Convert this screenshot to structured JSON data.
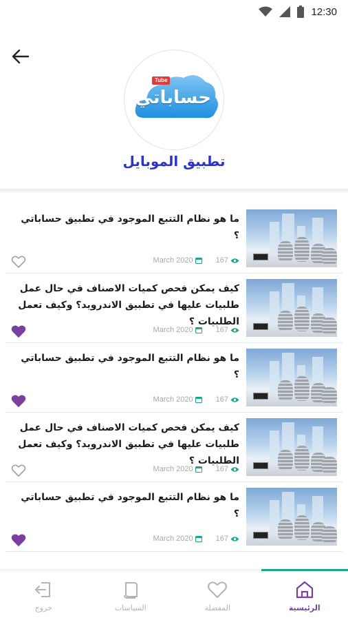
{
  "status_bar": {
    "time": "12:30"
  },
  "header": {
    "title": "تطبيق الموبايل",
    "logo_text": "حساباتي",
    "logo_badge": "Tube"
  },
  "articles": [
    {
      "title": "ما هو نظام التتبع الموجود في تطبيق حساباتي ؟",
      "date": "March 2020",
      "views": "167",
      "favorited": false
    },
    {
      "title": "كيف يمكن فحص كميات الاصناف في حال عمل طلبيات عليها في تطبيق الاندرويد؟ وكيف تعمل الطلبيات ؟",
      "date": "March 2020",
      "views": "167",
      "favorited": true
    },
    {
      "title": "ما هو نظام التتبع الموجود في تطبيق حساباتي ؟",
      "date": "March 2020",
      "views": "167",
      "favorited": true
    },
    {
      "title": "كيف يمكن فحص كميات الاصناف في حال عمل طلبيات عليها في تطبيق الاندرويد؟ وكيف تعمل الطلبيات ؟",
      "date": "March 2020",
      "views": "167",
      "favorited": false
    },
    {
      "title": "ما هو نظام التتبع الموجود في تطبيق حساباتي ؟",
      "date": "March 2020",
      "views": "167",
      "favorited": true
    }
  ],
  "bottom_nav": [
    {
      "label": "الرئيسية",
      "icon": "home-icon",
      "active": true
    },
    {
      "label": "المفضلة",
      "icon": "heart-icon",
      "active": false
    },
    {
      "label": "السياسات",
      "icon": "document-icon",
      "active": false
    },
    {
      "label": "خروج",
      "icon": "logout-icon",
      "active": false
    }
  ],
  "colors": {
    "title_blue": "#2b34c8",
    "accent_purple": "#7b3fa0",
    "accent_teal": "#19a68e",
    "meta_gray": "#a8a8a8"
  }
}
